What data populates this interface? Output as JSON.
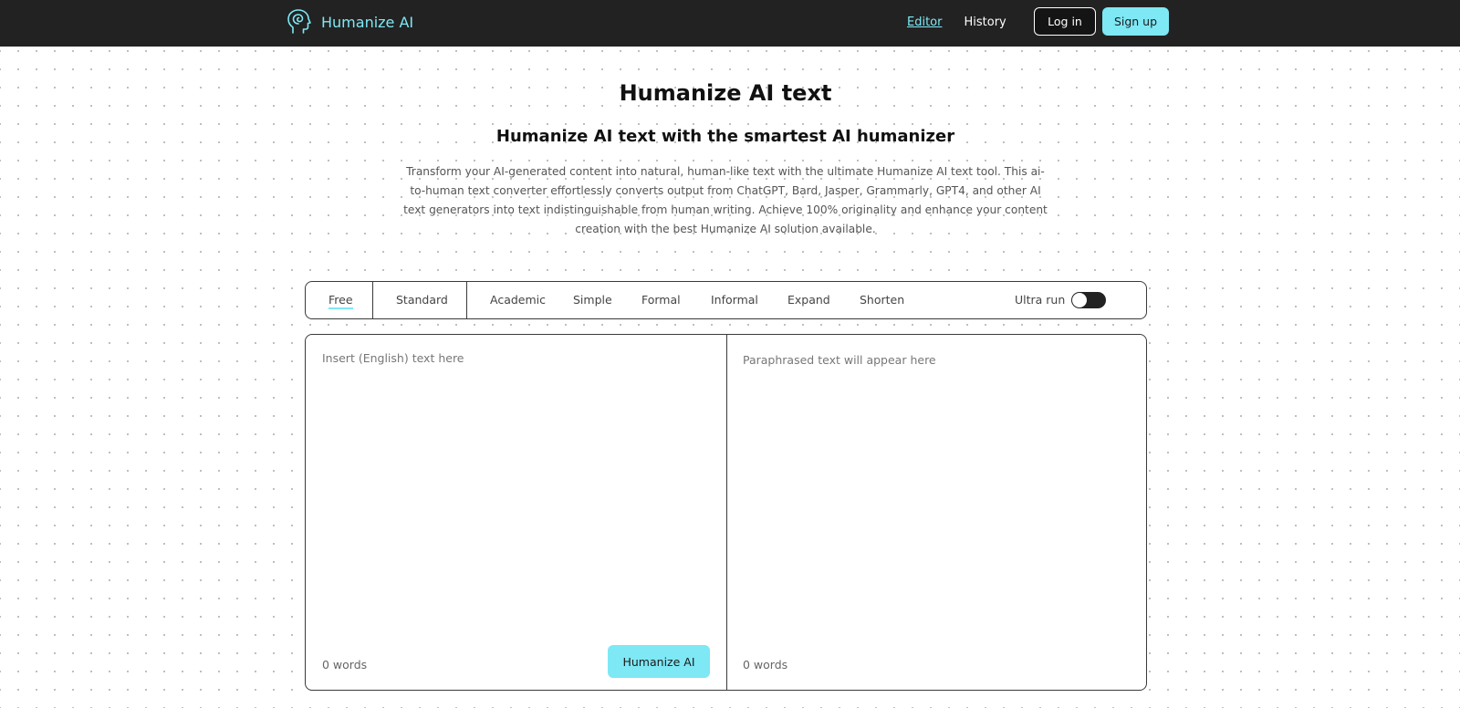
{
  "header": {
    "brand_name": "Humanize AI",
    "brand_icon": "head-spiral-icon",
    "nav": [
      {
        "label": "Editor",
        "active": true
      },
      {
        "label": "History",
        "active": false
      }
    ],
    "login_label": "Log in",
    "signup_label": "Sign up"
  },
  "hero": {
    "title": "Humanize AI text",
    "subtitle": "Humanize AI text with the smartest AI humanizer",
    "description": "Transform your AI-generated content into natural, human-like text with the ultimate Humanize AI text tool. This ai-to-human text converter effortlessly converts output from ChatGPT, Bard, Jasper, Grammarly, GPT4, and other AI text generators into text indistinguishable from human writing. Achieve 100% originality and enhance your content creation with the best Humanize AI solution available."
  },
  "modes": {
    "tabs": [
      {
        "label": "Free",
        "active": true
      },
      {
        "label": "Standard",
        "active": false
      },
      {
        "label": "Academic",
        "active": false
      },
      {
        "label": "Simple",
        "active": false
      },
      {
        "label": "Formal",
        "active": false
      },
      {
        "label": "Informal",
        "active": false
      },
      {
        "label": "Expand",
        "active": false
      },
      {
        "label": "Shorten",
        "active": false
      }
    ],
    "ultra_label": "Ultra run",
    "ultra_enabled": false
  },
  "editor": {
    "input_placeholder": "Insert (English) text here",
    "input_value": "",
    "input_word_count": "0 words",
    "output_placeholder": "Paraphrased text will appear here",
    "output_word_count": "0 words",
    "humanize_label": "Humanize AI"
  },
  "colors": {
    "accent": "#7ee8f5",
    "header_bg": "#222222"
  }
}
